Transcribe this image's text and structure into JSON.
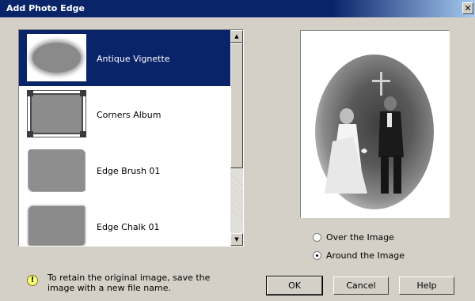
{
  "window": {
    "title": "Add Photo Edge",
    "close_glyph": "✕"
  },
  "edge_list": {
    "items": [
      {
        "label": "Antique Vignette",
        "selected": true,
        "thumbnail": "antique-vignette-thumbnail"
      },
      {
        "label": "Corners Album",
        "selected": false,
        "thumbnail": "corners-album-thumbnail"
      },
      {
        "label": "Edge Brush 01",
        "selected": false,
        "thumbnail": "edge-brush-thumbnail"
      },
      {
        "label": "Edge Chalk 01",
        "selected": false,
        "thumbnail": "edge-chalk-thumbnail"
      }
    ],
    "scroll_up_glyph": "▲",
    "scroll_down_glyph": "▼"
  },
  "placement": {
    "options": [
      {
        "label": "Over the Image",
        "checked": false
      },
      {
        "label": "Around the Image",
        "checked": true
      }
    ]
  },
  "hint": {
    "icon": "lightbulb-icon",
    "text_line1": "To retain the original image, save the",
    "text_line2": "image with a new file name."
  },
  "buttons": {
    "ok": "OK",
    "cancel": "Cancel",
    "help": "Help"
  },
  "colors": {
    "title_bar": "#0a246a",
    "selection": "#0a246a",
    "dialog_bg": "#d4d0c8"
  }
}
